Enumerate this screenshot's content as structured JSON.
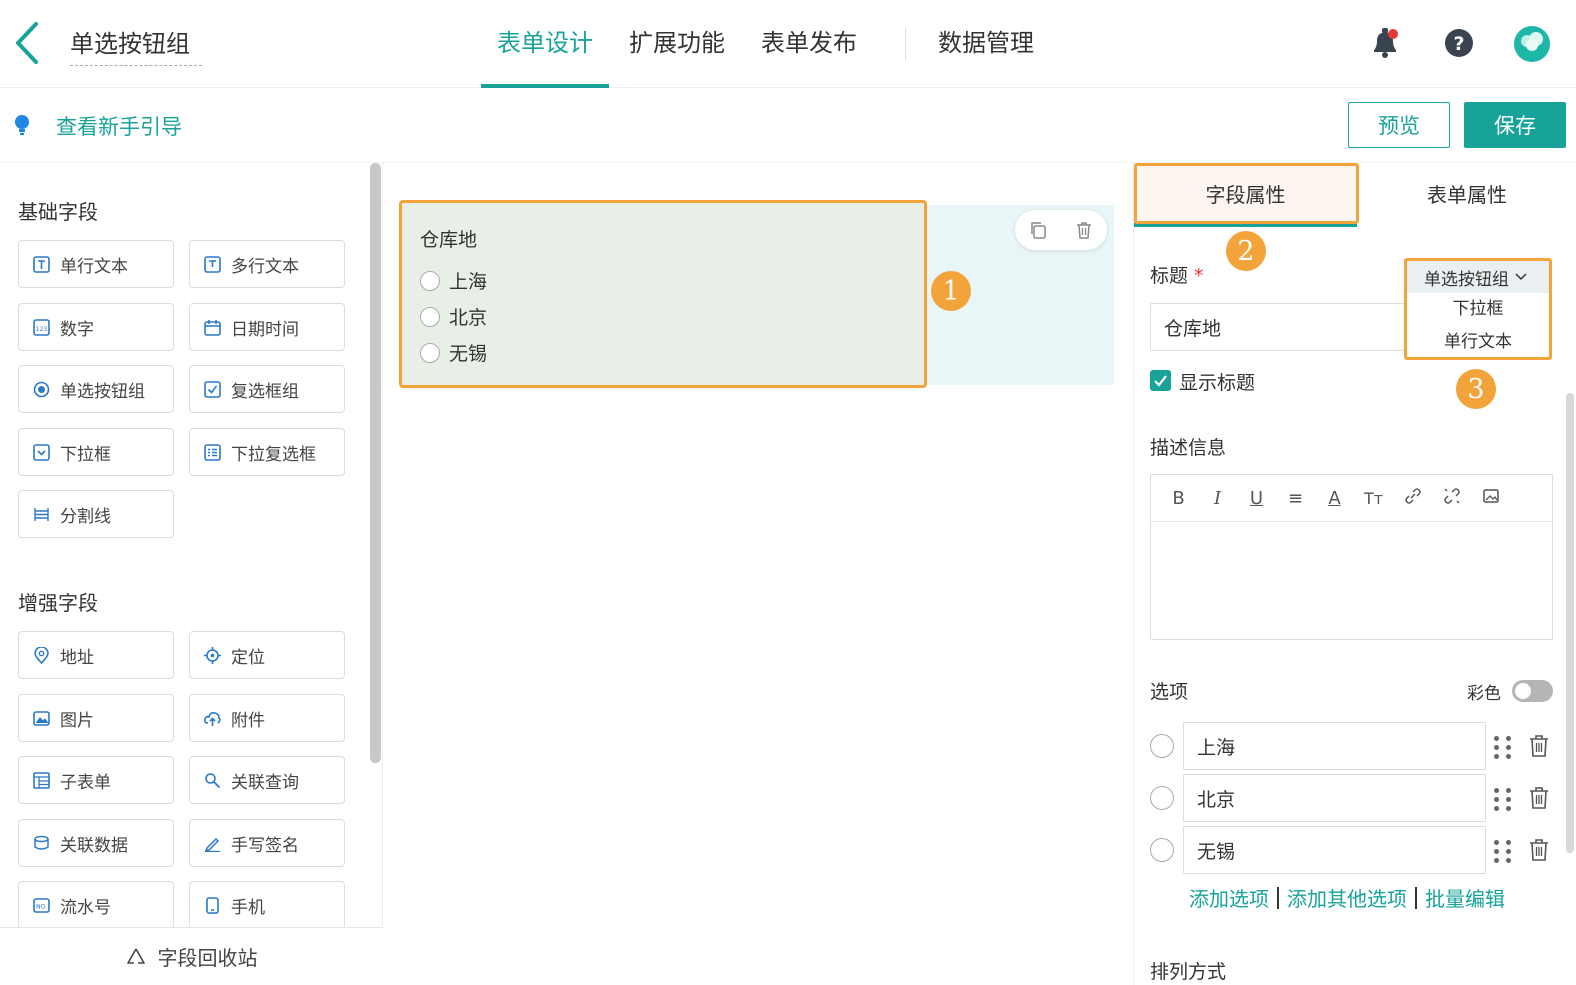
{
  "header": {
    "form_name": "单选按钮组",
    "tabs": [
      {
        "label": "表单设计",
        "active": true
      },
      {
        "label": "扩展功能",
        "active": false
      },
      {
        "label": "表单发布",
        "active": false
      },
      {
        "label": "数据管理",
        "active": false
      }
    ],
    "icons": [
      "back-arrow-icon",
      "bell-icon",
      "help-icon",
      "avatar"
    ],
    "accent_color": "#17a29a"
  },
  "subbar": {
    "guide_label": "查看新手引导",
    "preview_label": "预览",
    "save_label": "保存"
  },
  "left_panel": {
    "basic_title": "基础字段",
    "basic_fields": [
      "单行文本",
      "多行文本",
      "数字",
      "日期时间",
      "单选按钮组",
      "复选框组",
      "下拉框",
      "下拉复选框",
      "分割线"
    ],
    "enhanced_title": "增强字段",
    "enhanced_fields": [
      "地址",
      "定位",
      "图片",
      "附件",
      "子表单",
      "关联查询",
      "关联数据",
      "手写签名",
      "流水号",
      "手机"
    ],
    "recycle_label": "字段回收站"
  },
  "canvas": {
    "field_title": "仓库地",
    "options": [
      "上海",
      "北京",
      "无锡"
    ],
    "badge_1": "1"
  },
  "properties": {
    "tab_field": "字段属性",
    "tab_form": "表单属性",
    "badge_2": "2",
    "badge_3": "3",
    "title_label": "标题",
    "required_mark": "*",
    "title_value": "仓库地",
    "type_dropdown": {
      "selected": "单选按钮组",
      "options": [
        "下拉框",
        "单行文本"
      ]
    },
    "show_title_label": "显示标题",
    "show_title_checked": true,
    "desc_label": "描述信息",
    "editor_tools": [
      "B",
      "I",
      "U",
      "≡",
      "A",
      "Tт",
      "link",
      "unlink",
      "image"
    ],
    "options_label": "选项",
    "color_label": "彩色",
    "color_on": false,
    "option_values": [
      "上海",
      "北京",
      "无锡"
    ],
    "add_option": "添加选项",
    "add_other": "添加其他选项",
    "batch_edit": "批量编辑",
    "layout_label": "排列方式",
    "highlight_color": "#f2a33a"
  }
}
